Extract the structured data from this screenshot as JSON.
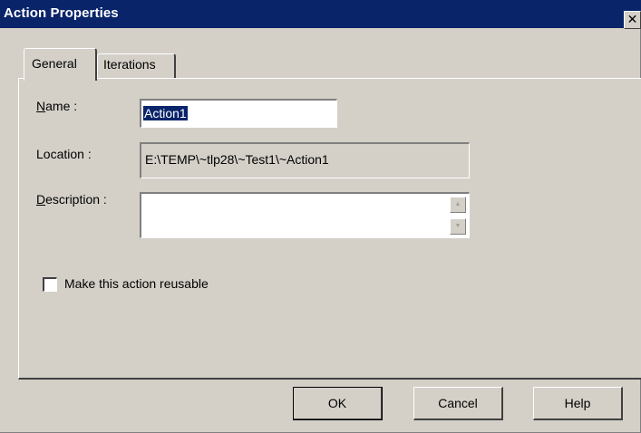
{
  "window": {
    "title": "Action Properties",
    "close_label": "✕"
  },
  "tabs": [
    {
      "label": "General",
      "selected": true
    },
    {
      "label": "Iterations",
      "selected": false
    }
  ],
  "form": {
    "name": {
      "label_mnemonic": "N",
      "label_rest": "ame :",
      "value": "Action1"
    },
    "location": {
      "label": "Location :",
      "value": "E:\\TEMP\\~tlp28\\~Test1\\~Action1"
    },
    "description": {
      "label_mnemonic": "D",
      "label_rest": "escription :",
      "value": ""
    },
    "reusable": {
      "label": "Make this action reusable",
      "checked": false
    }
  },
  "buttons": {
    "ok": "OK",
    "cancel": "Cancel",
    "help": "Help"
  },
  "colors": {
    "title_bar": "#0a246a",
    "dialog_face": "#d4d0c8"
  }
}
